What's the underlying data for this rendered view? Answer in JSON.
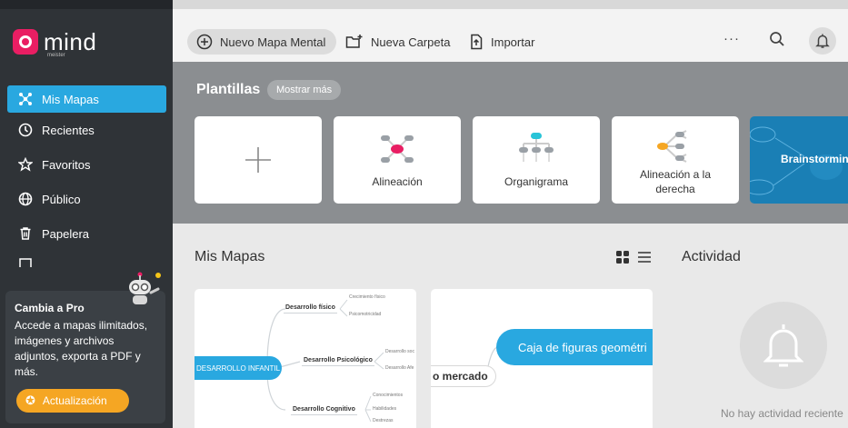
{
  "app": {
    "logo_text": "mind",
    "logo_sub": "meister"
  },
  "sidebar": {
    "items": [
      {
        "label": "Mis Mapas",
        "icon": "mindmap-icon"
      },
      {
        "label": "Recientes",
        "icon": "clock-icon"
      },
      {
        "label": "Favoritos",
        "icon": "star-icon"
      },
      {
        "label": "Público",
        "icon": "globe-icon"
      },
      {
        "label": "Papelera",
        "icon": "trash-icon"
      }
    ]
  },
  "promo": {
    "title": "Cambia a Pro",
    "text": "Accede a mapas ilimitados, imágenes y archivos adjuntos, exporta a PDF y más.",
    "button": "Actualización"
  },
  "toolbar": {
    "new_map": "Nuevo Mapa Mental",
    "new_folder": "Nueva Carpeta",
    "import": "Importar",
    "more": "···"
  },
  "templates": {
    "title": "Plantillas",
    "more": "Mostrar más",
    "cards": [
      "Alineación",
      "Organigrama",
      "Alineación a la derecha",
      "Brainstorming"
    ]
  },
  "maps": {
    "title": "Mis Mapas",
    "card1": {
      "root": "DESARROLLO INFANTIL",
      "branches": [
        "Desarrollo físico",
        "Desarrollo Psicológico",
        "Desarrollo Cognitivo"
      ],
      "leaves": [
        "Crecimiento físico",
        "Psicomotricidad",
        "Desarrollo soc",
        "Desarrollo Afe",
        "Conocimientos",
        "Habilidades",
        "Destrezas"
      ]
    },
    "card2": {
      "node": "Caja de figuras geométri",
      "label": "o mercado"
    }
  },
  "activity": {
    "title": "Actividad",
    "empty": "No hay actividad reciente"
  },
  "colors": {
    "accent": "#29a8e0",
    "brand": "#e91e63",
    "promo_button": "#f5a623",
    "sidebar": "#2f3337"
  }
}
